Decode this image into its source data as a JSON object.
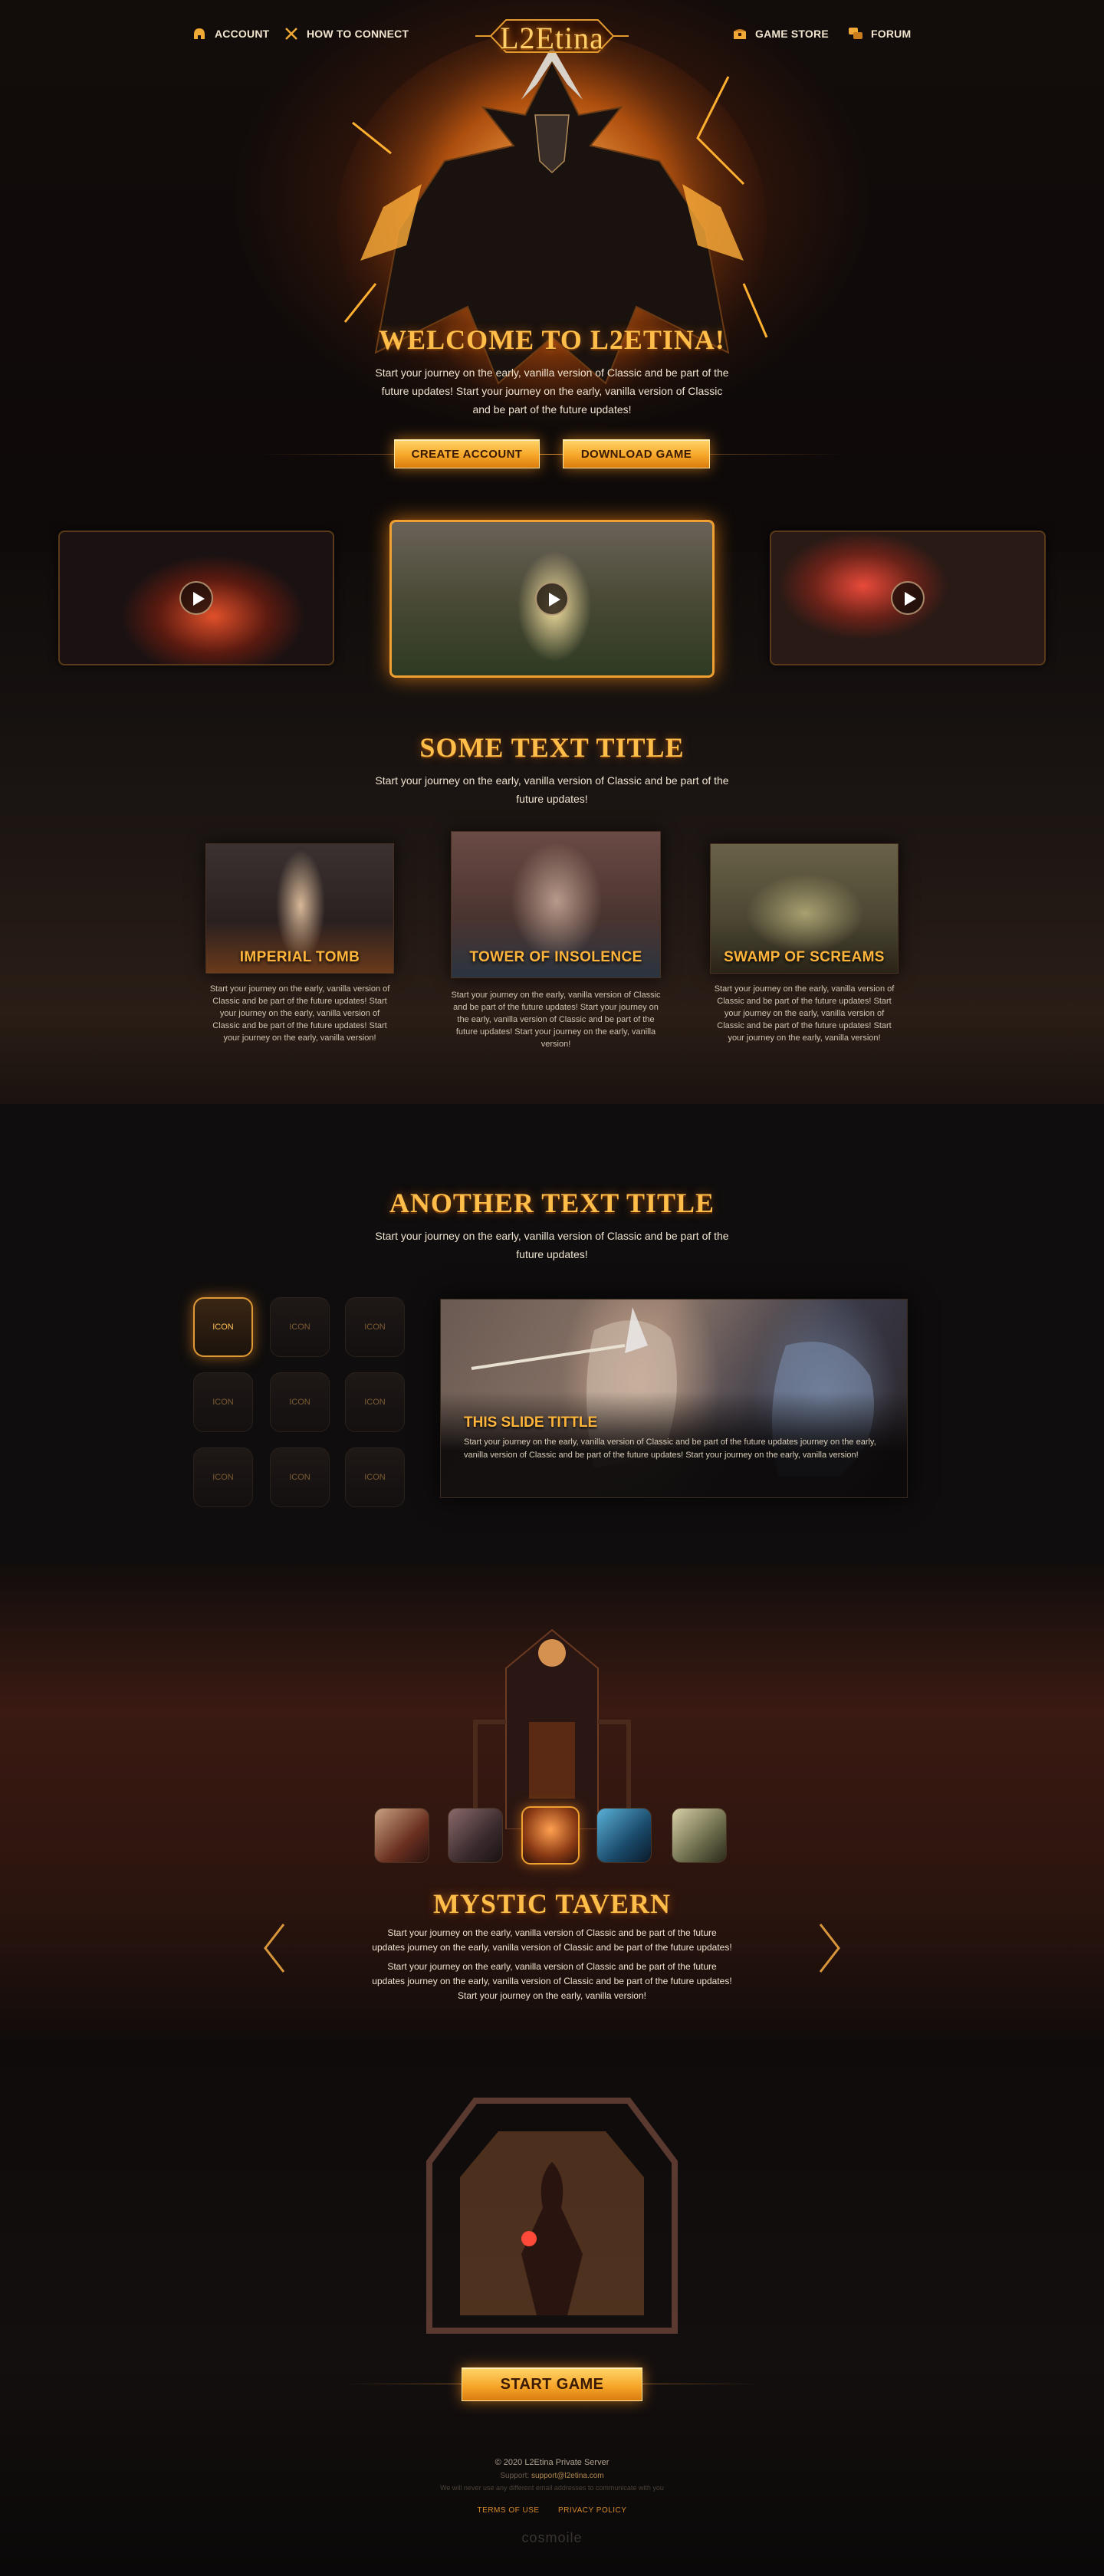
{
  "nav": {
    "account": "ACCOUNT",
    "how_to_connect": "HOW TO CONNECT",
    "game_store": "GAME STORE",
    "forum": "FORUM",
    "logo": "L2Etina"
  },
  "hero": {
    "title": "WELCOME TO L2ETINA!",
    "text": "Start your journey on the early, vanilla version of Classic and be part of the future updates! Start your journey on the early, vanilla version of Classic and be part of the future updates!",
    "create_account": "CREATE ACCOUNT",
    "download_game": "DOWNLOAD GAME"
  },
  "videos": [
    {
      "icon": "play-icon",
      "active": false
    },
    {
      "icon": "play-icon",
      "active": true
    },
    {
      "icon": "play-icon",
      "active": false
    }
  ],
  "section1": {
    "title": "SOME TEXT TITLE",
    "text": "Start your journey on the early, vanilla version of Classic and be part of the future updates!",
    "locations": [
      {
        "title": "IMPERIAL TOMB",
        "text": "Start your journey on the early, vanilla version of Classic and be part of the future updates! Start your journey on the early, vanilla version of Classic and be part of the future updates! Start your journey on the early, vanilla version!"
      },
      {
        "title": "TOWER OF INSOLENCE",
        "text": "Start your journey on the early, vanilla version of Classic and be part of the future updates! Start your journey on the early, vanilla version of Classic and be part of the future updates! Start your journey on the early, vanilla version!"
      },
      {
        "title": "SWAMP OF SCREAMS",
        "text": "Start your journey on the early, vanilla version of Classic and be part of the future updates! Start your journey on the early, vanilla version of Classic and be part of the future updates! Start your journey on the early, vanilla version!"
      }
    ]
  },
  "section2": {
    "title": "ANOTHER TEXT TITLE",
    "text": "Start your journey on the early, vanilla version of Classic and be part of the future updates!",
    "icons": [
      "ICON",
      "ICON",
      "ICON",
      "ICON",
      "ICON",
      "ICON",
      "ICON",
      "ICON",
      "ICON"
    ],
    "active_icon": 0,
    "slide_title": "THIS SLIDE TITTLE",
    "slide_text": "Start your journey on the early, vanilla version of Classic and be part of the future updates journey on the early, vanilla version of Classic and be part of the future updates! Start your journey on the early, vanilla version!"
  },
  "tavern": {
    "title": "MYSTIC TAVERN",
    "text1": "Start your journey on the early, vanilla version of Classic and be part of the future updates journey on the early, vanilla version of Classic and be part of the future updates!",
    "text2": "Start your journey on the early, vanilla version of Classic and be part of the future updates journey on the early, vanilla version of Classic and be part of the future updates! Start your journey on the early, vanilla version!",
    "active_thumb": 2,
    "thumb_count": 5
  },
  "final": {
    "start_game": "START GAME"
  },
  "footer": {
    "copyright": "© 2020 L2Etina Private Server",
    "support_label": "Support:",
    "support_email": "support@l2etina.com",
    "note": "We will never use any different email addresses to communicate with you",
    "terms": "TERMS OF USE",
    "privacy": "PRIVACY POLICY",
    "credit": "cosmoile"
  },
  "colors": {
    "accent": "#ffbe4a",
    "button": "#f7a72a",
    "background": "#0c0a0a"
  }
}
